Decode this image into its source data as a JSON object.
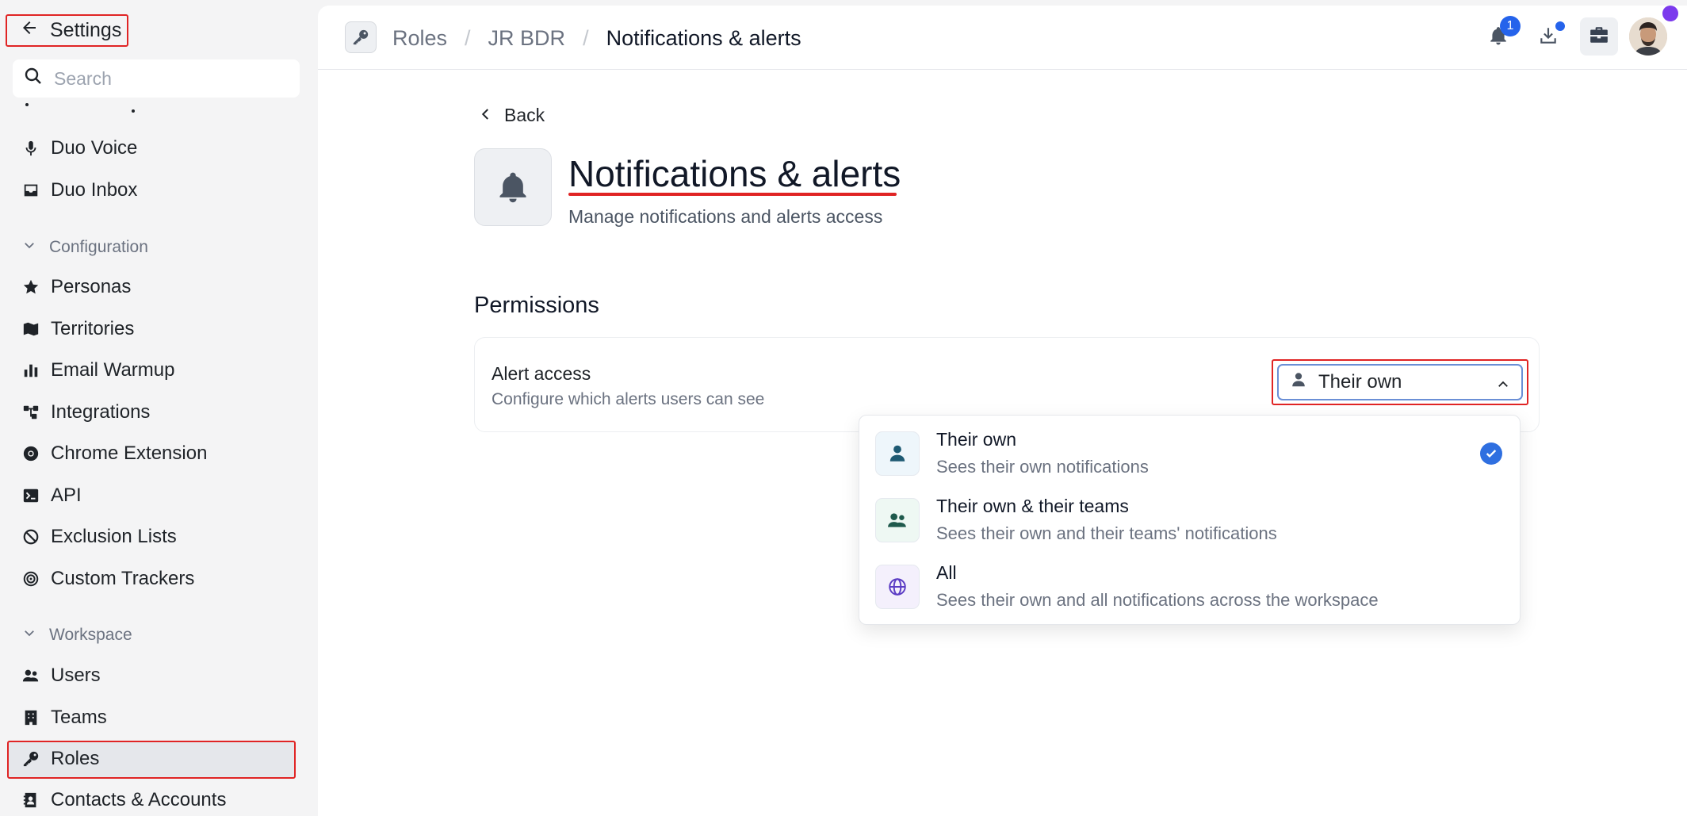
{
  "sidebar": {
    "back_label": "Settings",
    "search_placeholder": "Search",
    "items_top": [
      "Duo Voice",
      "Duo Inbox"
    ],
    "configuration_label": "Configuration",
    "configuration_items": [
      "Personas",
      "Territories",
      "Email Warmup",
      "Integrations",
      "Chrome Extension",
      "API",
      "Exclusion Lists",
      "Custom Trackers"
    ],
    "workspace_label": "Workspace",
    "workspace_items": [
      "Users",
      "Teams",
      "Roles",
      "Contacts & Accounts"
    ]
  },
  "topbar": {
    "breadcrumbs": [
      "Roles",
      "JR BDR",
      "Notifications & alerts"
    ],
    "notification_count": "1"
  },
  "content": {
    "back_label": "Back",
    "title": "Notifications & alerts",
    "subtitle": "Manage notifications and alerts access",
    "section_title": "Permissions",
    "permission": {
      "label": "Alert access",
      "description": "Configure which alerts users can see",
      "selected_value": "Their own"
    },
    "options": [
      {
        "title": "Their own",
        "description": "Sees their own notifications",
        "icon": "person-icon",
        "selected": true
      },
      {
        "title": "Their own & their teams",
        "description": "Sees their own and their teams' notifications",
        "icon": "people-icon",
        "selected": false
      },
      {
        "title": "All",
        "description": "Sees their own and all notifications across the workspace",
        "icon": "globe-icon",
        "selected": false
      }
    ]
  },
  "colors": {
    "accent": "#2563eb",
    "highlight": "#e02424",
    "avatar_status": "#7c3aed"
  }
}
